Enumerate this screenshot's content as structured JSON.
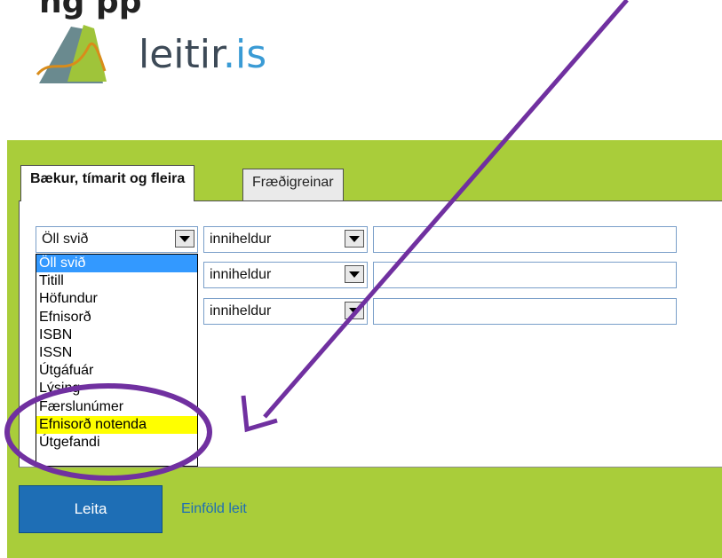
{
  "caption": "ng                                  pp",
  "logo": {
    "name": "leitir",
    "tld": ".is"
  },
  "tabs": [
    {
      "label": "Bækur, tímarit og fleira",
      "active": true
    },
    {
      "label": "Fræðigreinar",
      "active": false
    }
  ],
  "search_rows": [
    {
      "field": "Öll svið",
      "operator": "inniheldur",
      "value": ""
    },
    {
      "field": "",
      "operator": "inniheldur",
      "value": ""
    },
    {
      "field": "",
      "operator": "inniheldur",
      "value": ""
    }
  ],
  "field_dropdown": {
    "selected": "Öll svið",
    "highlighted": "Efnisorð notenda",
    "options": [
      "Öll svið",
      "Titill",
      "Höfundur",
      "Efnisorð",
      "ISBN",
      "ISSN",
      "Útgáfuár",
      "Lýsing",
      "Færslunúmer",
      "Efnisorð notenda",
      "Útgefandi"
    ]
  },
  "actions": {
    "search_label": "Leita",
    "simple_search_label": "Einföld leit"
  },
  "colors": {
    "green_band": "#a9cd3a",
    "annotation": "#7030a0",
    "highlight": "#ffff00",
    "button": "#1e6eb5"
  }
}
